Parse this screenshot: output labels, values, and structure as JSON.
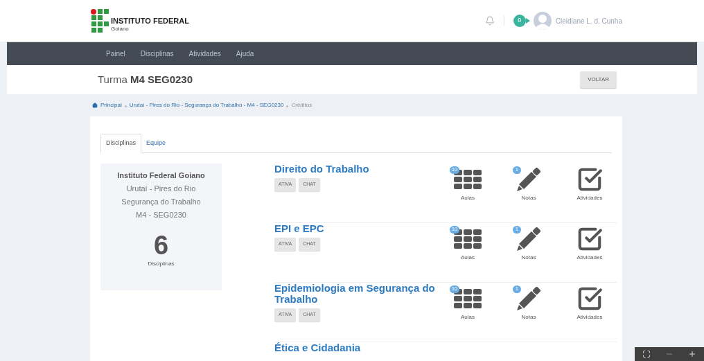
{
  "header": {
    "logo": {
      "line1": "INSTITUTO FEDERAL",
      "line2": "Goiano"
    },
    "notification_count": "0",
    "user_name": "Cleidiane L. d. Cunha"
  },
  "nav": [
    "Painel",
    "Disciplinas",
    "Atividades",
    "Ajuda"
  ],
  "page_title": {
    "prefix": "Turma",
    "code": "M4 SEG0230"
  },
  "back_button": "VOLTAR",
  "breadcrumb": [
    {
      "label": "Principal",
      "kind": "link"
    },
    {
      "label": "Urutaí - Pires do Rio - Segurança do Trabalho - M4 - SEG0230",
      "kind": "link"
    },
    {
      "label": "Créditos",
      "kind": "current"
    }
  ],
  "tabs": [
    {
      "label": "Disciplinas",
      "selected": true
    },
    {
      "label": "Equipe",
      "selected": false
    }
  ],
  "summary": {
    "institution": "Instituto Federal Goiano",
    "lines": [
      "Urutaí - Pires do Rio",
      "Segurança do Trabalho",
      "M4 - SEG0230"
    ],
    "count": "6",
    "count_label": "Disciplinas"
  },
  "courses": [
    {
      "title": "Direito do Trabalho",
      "tags": [
        "ATIVA",
        "CHAT"
      ],
      "actions": [
        {
          "kind": "aulas",
          "label": "Aulas",
          "badge": "10"
        },
        {
          "kind": "notas",
          "label": "Notas",
          "badge": "1"
        },
        {
          "kind": "atividades",
          "label": "Atividades"
        }
      ]
    },
    {
      "title": "EPI e EPC",
      "tags": [
        "ATIVA",
        "CHAT"
      ],
      "actions": [
        {
          "kind": "aulas",
          "label": "Aulas",
          "badge": "10"
        },
        {
          "kind": "notas",
          "label": "Notas",
          "badge": "1"
        },
        {
          "kind": "atividades",
          "label": "Atividades"
        }
      ]
    },
    {
      "title": "Epidemiologia em Segurança do Trabalho",
      "tags": [
        "ATIVA",
        "CHAT"
      ],
      "actions": [
        {
          "kind": "aulas",
          "label": "Aulas",
          "badge": "10"
        },
        {
          "kind": "notas",
          "label": "Notas",
          "badge": "1"
        },
        {
          "kind": "atividades",
          "label": "Atividades"
        }
      ]
    },
    {
      "title": "Ética e Cidadania"
    }
  ]
}
